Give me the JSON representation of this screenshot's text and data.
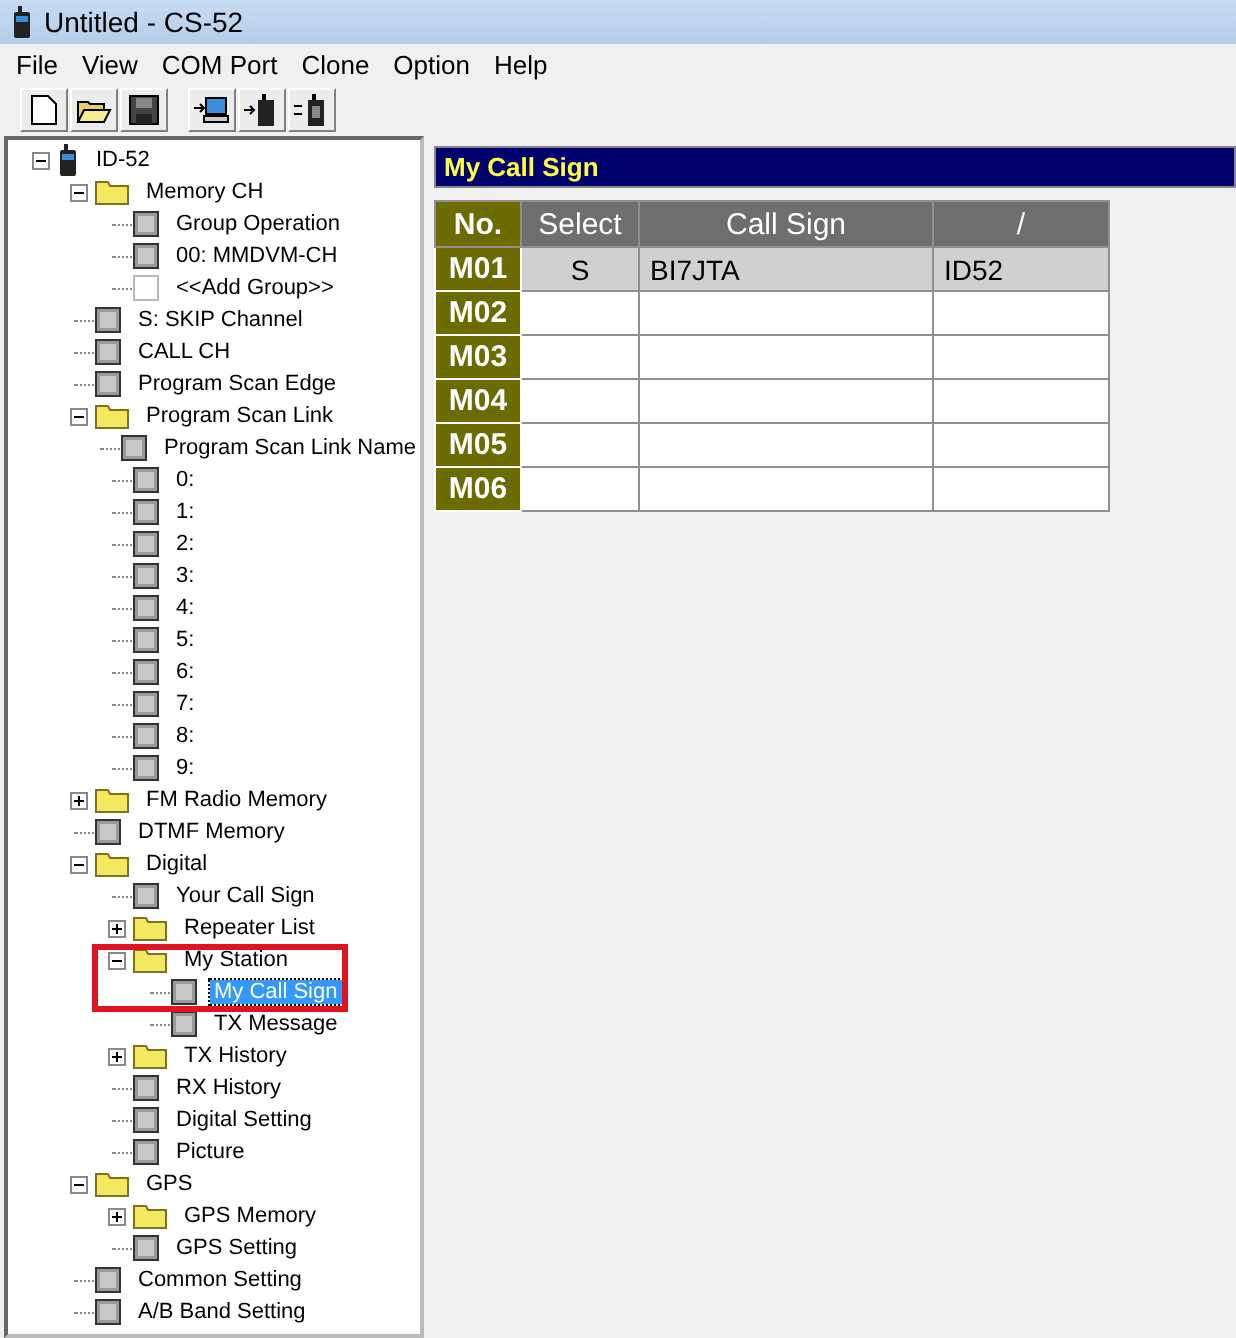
{
  "window": {
    "title": "Untitled - CS-52"
  },
  "menu": [
    "File",
    "View",
    "COM Port",
    "Clone",
    "Option",
    "Help"
  ],
  "tree": [
    {
      "label": "ID-52",
      "kind": "radio",
      "expanded": true,
      "selected": false,
      "children": [
        {
          "label": "Memory CH",
          "kind": "folder",
          "expanded": true,
          "selected": false,
          "children": [
            {
              "label": "Group Operation",
              "kind": "item",
              "selected": false
            },
            {
              "label": "00: MMDVM-CH",
              "kind": "item",
              "selected": false
            },
            {
              "label": "<<Add Group>>",
              "kind": "add",
              "selected": false
            }
          ]
        },
        {
          "label": "S: SKIP Channel",
          "kind": "item",
          "selected": false
        },
        {
          "label": "CALL CH",
          "kind": "item",
          "selected": false
        },
        {
          "label": "Program Scan Edge",
          "kind": "item",
          "selected": false
        },
        {
          "label": "Program Scan Link",
          "kind": "folder",
          "expanded": true,
          "selected": false,
          "children": [
            {
              "label": "Program Scan Link Name",
              "kind": "item",
              "selected": false
            },
            {
              "label": "0:",
              "kind": "item",
              "selected": false
            },
            {
              "label": "1:",
              "kind": "item",
              "selected": false
            },
            {
              "label": "2:",
              "kind": "item",
              "selected": false
            },
            {
              "label": "3:",
              "kind": "item",
              "selected": false
            },
            {
              "label": "4:",
              "kind": "item",
              "selected": false
            },
            {
              "label": "5:",
              "kind": "item",
              "selected": false
            },
            {
              "label": "6:",
              "kind": "item",
              "selected": false
            },
            {
              "label": "7:",
              "kind": "item",
              "selected": false
            },
            {
              "label": "8:",
              "kind": "item",
              "selected": false
            },
            {
              "label": "9:",
              "kind": "item",
              "selected": false
            }
          ]
        },
        {
          "label": "FM Radio Memory",
          "kind": "folder",
          "expanded": false,
          "selected": false
        },
        {
          "label": "DTMF Memory",
          "kind": "item",
          "selected": false
        },
        {
          "label": "Digital",
          "kind": "folder",
          "expanded": true,
          "selected": false,
          "children": [
            {
              "label": "Your Call Sign",
              "kind": "item",
              "selected": false
            },
            {
              "label": "Repeater List",
              "kind": "folder",
              "expanded": false,
              "selected": false
            },
            {
              "label": "My Station",
              "kind": "folder",
              "expanded": true,
              "selected": false,
              "highlighted": true,
              "children": [
                {
                  "label": "My Call Sign",
                  "kind": "item",
                  "selected": true
                },
                {
                  "label": "TX Message",
                  "kind": "item",
                  "selected": false
                }
              ]
            },
            {
              "label": "TX History",
              "kind": "folder",
              "expanded": false,
              "selected": false
            },
            {
              "label": "RX History",
              "kind": "item",
              "selected": false
            },
            {
              "label": "Digital Setting",
              "kind": "item",
              "selected": false
            },
            {
              "label": "Picture",
              "kind": "item",
              "selected": false
            }
          ]
        },
        {
          "label": "GPS",
          "kind": "folder",
          "expanded": true,
          "selected": false,
          "children": [
            {
              "label": "GPS Memory",
              "kind": "folder",
              "expanded": false,
              "selected": false
            },
            {
              "label": "GPS Setting",
              "kind": "item",
              "selected": false
            }
          ]
        },
        {
          "label": "Common Setting",
          "kind": "item",
          "selected": false
        },
        {
          "label": "A/B Band Setting",
          "kind": "item",
          "selected": false
        }
      ]
    }
  ],
  "panel": {
    "title": "My Call Sign",
    "columns": [
      "No.",
      "Select",
      "Call Sign",
      "/"
    ],
    "rows": [
      {
        "cells": [
          "M01",
          "S",
          "BI7JTA",
          "ID52"
        ]
      },
      {
        "cells": [
          "M02",
          "",
          "",
          ""
        ]
      },
      {
        "cells": [
          "M03",
          "",
          "",
          ""
        ]
      },
      {
        "cells": [
          "M04",
          "",
          "",
          ""
        ]
      },
      {
        "cells": [
          "M05",
          "",
          "",
          ""
        ]
      },
      {
        "cells": [
          "M06",
          "",
          "",
          ""
        ]
      }
    ]
  }
}
